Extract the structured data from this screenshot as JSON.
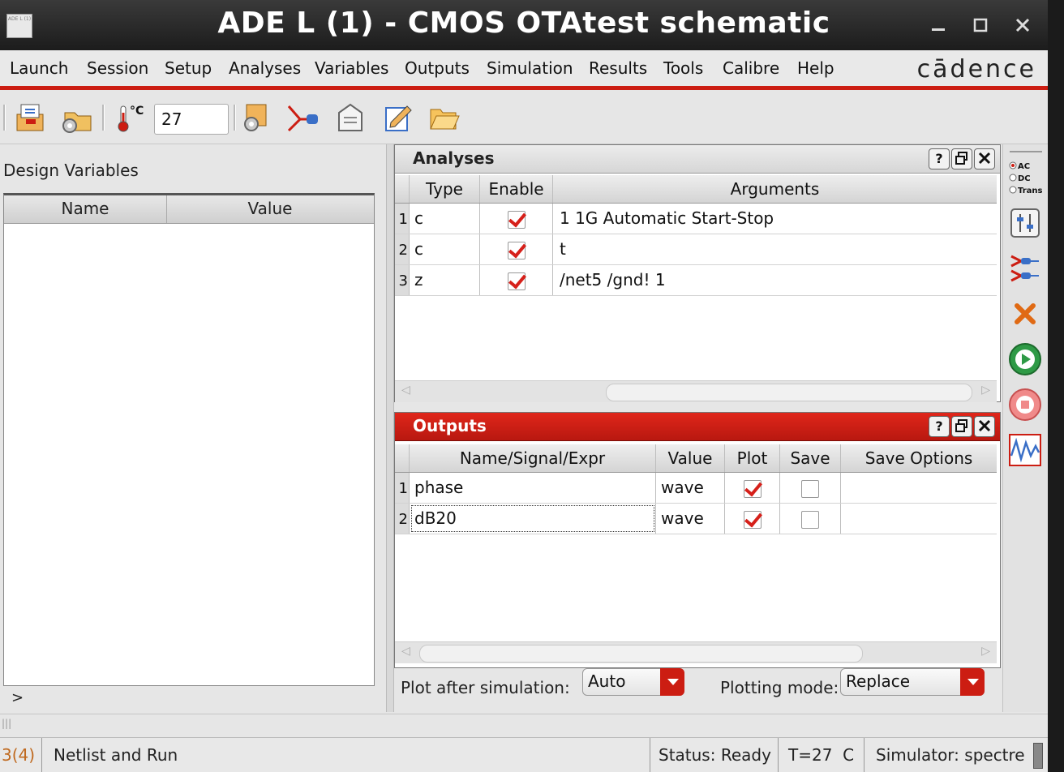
{
  "window": {
    "title": "ADE L (1) - CMOS OTAtest schematic",
    "app_icon_text": "ADE L (1)",
    "controls": [
      "minimize",
      "maximize",
      "close"
    ]
  },
  "menubar": {
    "items": [
      {
        "label": "Launch"
      },
      {
        "label": "Session"
      },
      {
        "label": "Setup"
      },
      {
        "label": "Analyses"
      },
      {
        "label": "Variables"
      },
      {
        "label": "Outputs"
      },
      {
        "label": "Simulation"
      },
      {
        "label": "Results"
      },
      {
        "label": "Tools"
      },
      {
        "label": "Calibre"
      },
      {
        "label": "Help"
      }
    ],
    "brand": "cādence"
  },
  "toolbar": {
    "temperature": "27",
    "temperature_unit": "°C",
    "icons": [
      "load-state-icon",
      "save-state-icon",
      "temperature-icon",
      "setup-model-libraries-icon",
      "edit-variables-icon",
      "copy-variables-icon",
      "edit-icon",
      "open-folder-icon"
    ]
  },
  "design_variables": {
    "label": "Design Variables",
    "columns": [
      "Name",
      "Value"
    ],
    "rows": [],
    "prompt": ">"
  },
  "analyses": {
    "title": "Analyses",
    "panel_buttons": [
      "?",
      "restore",
      "close"
    ],
    "columns": [
      "Type",
      "Enable",
      "Arguments"
    ],
    "rows": [
      {
        "num": "1",
        "type": "c",
        "enabled": true,
        "arguments": "1 1G Automatic Start-Stop"
      },
      {
        "num": "2",
        "type": "c",
        "enabled": true,
        "arguments": "t"
      },
      {
        "num": "3",
        "type": "z",
        "enabled": true,
        "arguments": "/net5 /gnd! 1"
      }
    ]
  },
  "outputs": {
    "title": "Outputs",
    "panel_buttons": [
      "?",
      "restore",
      "close"
    ],
    "columns": [
      "Name/Signal/Expr",
      "Value",
      "Plot",
      "Save",
      "Save Options"
    ],
    "rows": [
      {
        "num": "1",
        "name": "phase",
        "value": "wave",
        "plot": true,
        "save": false,
        "save_options": ""
      },
      {
        "num": "2",
        "name": "dB20",
        "value": "wave",
        "plot": true,
        "save": false,
        "save_options": ""
      }
    ]
  },
  "plot_controls": {
    "plot_after_label": "Plot after simulation:",
    "plot_after_value": "Auto",
    "plotting_mode_label": "Plotting mode:",
    "plotting_mode_value": "Replace"
  },
  "side_toolbar": {
    "analysis_choices": [
      "AC",
      "DC",
      "Trans"
    ],
    "selected_choice": "AC",
    "buttons": [
      "tune-parameters-icon",
      "netlist-icon",
      "delete-icon",
      "run-icon",
      "stop-icon",
      "plot-outputs-icon"
    ]
  },
  "statusbar": {
    "cell": "3(4)",
    "command": "Netlist and Run",
    "status": "Status: Ready",
    "temperature": "T=27",
    "temp_unit": "C",
    "simulator": "Simulator: spectre"
  },
  "colors": {
    "accent_red": "#cc1d12",
    "panel_header_gray": "#e0e0e0",
    "background": "#e6e6e6"
  }
}
